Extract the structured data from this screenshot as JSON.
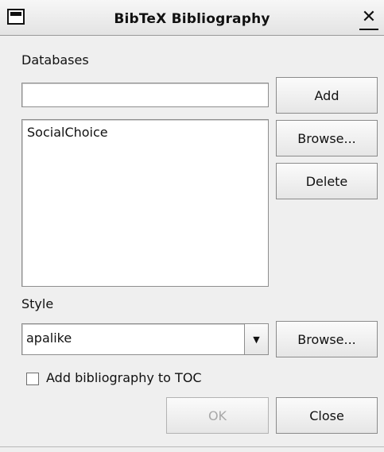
{
  "window": {
    "title": "BibTeX Bibliography"
  },
  "databases": {
    "label": "Databases",
    "input_value": "",
    "add_button": "Add",
    "browse_button": "Browse...",
    "delete_button": "Delete",
    "items": [
      "SocialChoice"
    ]
  },
  "style": {
    "label": "Style",
    "selected": "apalike",
    "browse_button": "Browse..."
  },
  "toc_checkbox": {
    "label": "Add bibliography to TOC",
    "checked": false
  },
  "footer": {
    "ok_label": "OK",
    "close_label": "Close"
  }
}
